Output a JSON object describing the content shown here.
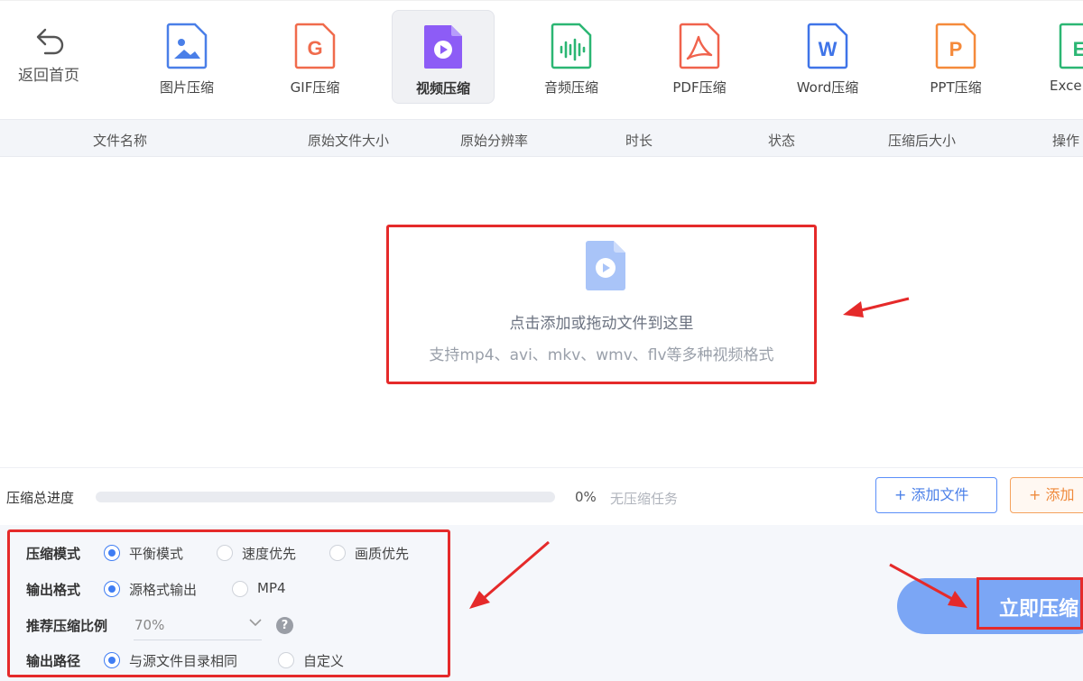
{
  "toolbar": {
    "back_label": "返回首页",
    "tools": [
      {
        "label": "图片压缩",
        "icon": "image-file-icon",
        "color": "#4a7fe8"
      },
      {
        "label": "GIF压缩",
        "icon": "gif-file-icon",
        "color": "#f06b4c"
      },
      {
        "label": "视频压缩",
        "icon": "video-file-icon",
        "color": "#8d5cf6",
        "active": true
      },
      {
        "label": "音频压缩",
        "icon": "audio-file-icon",
        "color": "#2bb673"
      },
      {
        "label": "PDF压缩",
        "icon": "pdf-file-icon",
        "color": "#f0624c"
      },
      {
        "label": "Word压缩",
        "icon": "word-file-icon",
        "color": "#3f74e8"
      },
      {
        "label": "PPT压缩",
        "icon": "ppt-file-icon",
        "color": "#f58a3b"
      },
      {
        "label": "Exce",
        "icon": "excel-file-icon",
        "color": "#2bb673"
      }
    ]
  },
  "table": {
    "columns": [
      "文件名称",
      "原始文件大小",
      "原始分辨率",
      "时长",
      "状态",
      "压缩后大小",
      "操作"
    ]
  },
  "dropzone": {
    "title": "点击添加或拖动文件到这里",
    "subtitle": "支持mp4、avi、mkv、wmv、flv等多种视频格式"
  },
  "progress": {
    "label": "压缩总进度",
    "percent": 0,
    "percent_text": "0%",
    "status": "无压缩任务",
    "add_file_label": "+ 添加文件",
    "add_folder_label": "+ 添加"
  },
  "settings": {
    "mode": {
      "label": "压缩模式",
      "options": [
        "平衡模式",
        "速度优先",
        "画质优先"
      ],
      "selected": 0
    },
    "format": {
      "label": "输出格式",
      "options": [
        "源格式输出",
        "MP4"
      ],
      "selected": 0
    },
    "ratio": {
      "label": "推荐压缩比例",
      "value": "70%",
      "help": "?"
    },
    "path": {
      "label": "输出路径",
      "options": [
        "与源文件目录相同",
        "自定义"
      ],
      "selected": 0
    }
  },
  "start_button": {
    "label": "立即压缩"
  },
  "colors": {
    "accent": "#3f7df3",
    "annotation_red": "#e52a2a"
  }
}
